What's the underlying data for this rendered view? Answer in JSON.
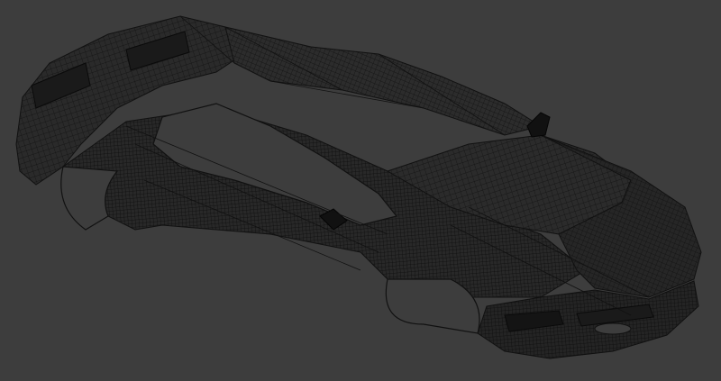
{
  "viewport": {
    "background": "#3d3d3d",
    "mesh_color": "#111111",
    "shade_color": "#262626"
  },
  "model": {
    "icon": "car-wireframe-icon"
  }
}
